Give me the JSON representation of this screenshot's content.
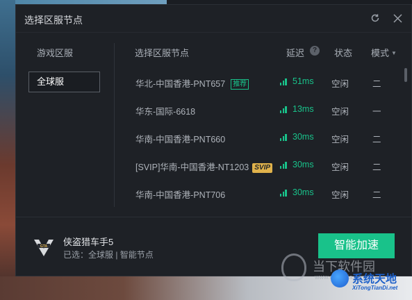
{
  "dialog": {
    "title": "选择区服节点"
  },
  "left_panel": {
    "header": "游戏区服",
    "selected_region": "全球服"
  },
  "node_table": {
    "columns": {
      "name": "选择区服节点",
      "delay": "延迟",
      "status": "状态",
      "mode": "模式"
    },
    "rows": [
      {
        "name": "华北-中国香港-PNT657",
        "tag": "推荐",
        "latency": "51ms",
        "status": "空闲",
        "mode": "二"
      },
      {
        "name": "华东-国际-6618",
        "tag": "",
        "latency": "13ms",
        "status": "空闲",
        "mode": "一"
      },
      {
        "name": "华南-中国香港-PNT660",
        "tag": "",
        "latency": "30ms",
        "status": "空闲",
        "mode": "二"
      },
      {
        "name": "[SVIP]华南-中国香港-NT1203",
        "tag": "SVIP",
        "latency": "30ms",
        "status": "空闲",
        "mode": "二"
      },
      {
        "name": "华南-中国香港-PNT706",
        "tag": "",
        "latency": "30ms",
        "status": "空闲",
        "mode": "二"
      }
    ]
  },
  "footer": {
    "game_name": "侠盗猎车手5",
    "selected": "已选：全球服 | 智能节点",
    "accelerate_button": "智能加速"
  },
  "watermark": {
    "site_cn": "当下软件园",
    "site_url": "www.downxia.com",
    "brand": "系统天地",
    "brand_url": "XiTongTianDi.net"
  },
  "colors": {
    "accent_green": "#19c28a",
    "svip_gold": "#e0b24b",
    "dialog_bg": "#1e2126"
  },
  "icons": [
    "refresh-icon",
    "close-icon",
    "help-icon",
    "caret-down-icon",
    "signal-icon",
    "gta5-logo-icon"
  ]
}
